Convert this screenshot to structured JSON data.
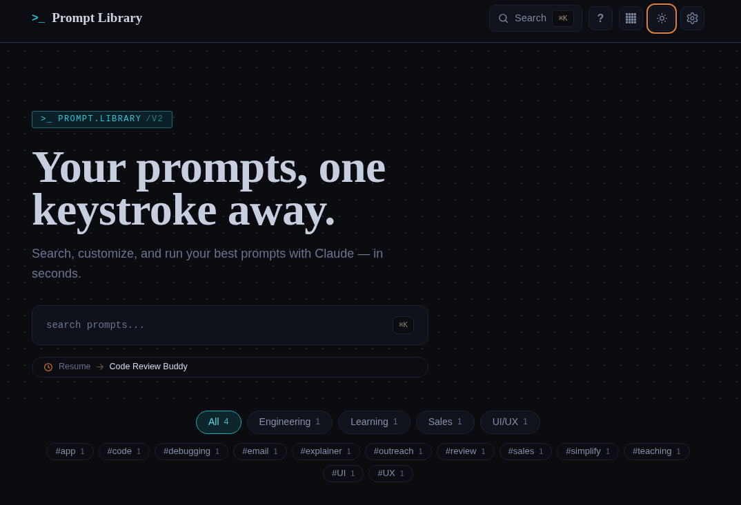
{
  "header": {
    "logo_mark": ">_",
    "title": "Prompt Library",
    "search": {
      "label": "Search",
      "shortcut": "⌘K"
    },
    "buttons": [
      {
        "kind": "help",
        "label": "?",
        "focused": false
      },
      {
        "kind": "grid",
        "focused": false
      },
      {
        "kind": "theme",
        "focused": true
      },
      {
        "kind": "settings",
        "focused": false
      }
    ]
  },
  "hero": {
    "badge": {
      "mark": ">_",
      "label": "PROMPT.LIBRARY",
      "version": "/V2"
    },
    "headline": "Your prompts, one keystroke away.",
    "subtitle": "Search, customize, and run your best prompts with Claude — in seconds.",
    "search": {
      "placeholder": "search prompts...",
      "shortcut": "⌘K"
    },
    "resume": {
      "label": "Resume",
      "prompt": "Code Review Buddy"
    }
  },
  "categories": [
    {
      "label": "All",
      "count": "4",
      "selected": true
    },
    {
      "label": "Engineering",
      "count": "1",
      "selected": false
    },
    {
      "label": "Learning",
      "count": "1",
      "selected": false
    },
    {
      "label": "Sales",
      "count": "1",
      "selected": false
    },
    {
      "label": "UI/UX",
      "count": "1",
      "selected": false
    }
  ],
  "tags": [
    {
      "label": "#app",
      "count": "1"
    },
    {
      "label": "#code",
      "count": "1"
    },
    {
      "label": "#debugging",
      "count": "1"
    },
    {
      "label": "#email",
      "count": "1"
    },
    {
      "label": "#explainer",
      "count": "1"
    },
    {
      "label": "#outreach",
      "count": "1"
    },
    {
      "label": "#review",
      "count": "1"
    },
    {
      "label": "#sales",
      "count": "1"
    },
    {
      "label": "#simplify",
      "count": "1"
    },
    {
      "label": "#teaching",
      "count": "1"
    },
    {
      "label": "#UI",
      "count": "1"
    },
    {
      "label": "#UX",
      "count": "1"
    }
  ]
}
